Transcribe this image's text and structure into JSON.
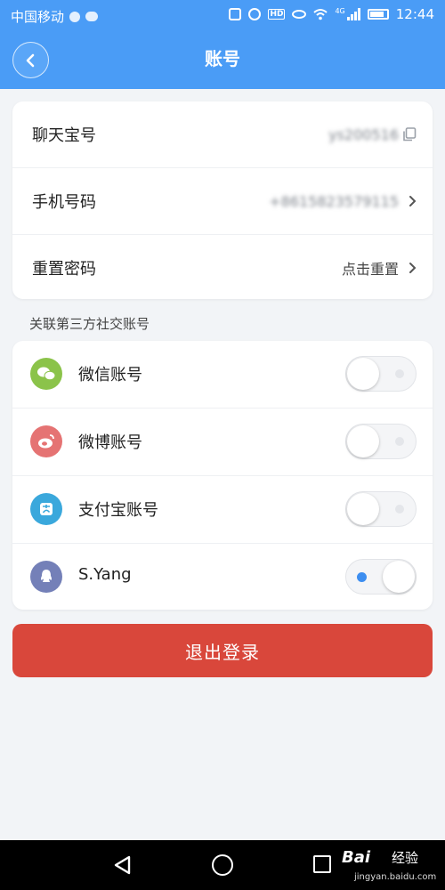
{
  "status_bar": {
    "carrier": "中国移动",
    "network_type": "4G",
    "hd_badge": "HD",
    "time": "12:44"
  },
  "header": {
    "title": "账号",
    "back_icon": "chevron-left-icon"
  },
  "account": {
    "rows": [
      {
        "label": "聊天宝号",
        "value": "ys200516",
        "icon": "copy-icon"
      },
      {
        "label": "手机号码",
        "value": "+8615823579115",
        "icon": "chevron-right-icon"
      },
      {
        "label": "重置密码",
        "value": "点击重置",
        "icon": "chevron-right-icon"
      }
    ]
  },
  "social": {
    "section_title": "关联第三方社交账号",
    "items": [
      {
        "label": "微信账号",
        "icon": "wechat-icon",
        "color": "#8bc34a",
        "enabled": false
      },
      {
        "label": "微博账号",
        "icon": "weibo-icon",
        "color": "#e57373",
        "enabled": false
      },
      {
        "label": "支付宝账号",
        "icon": "alipay-icon",
        "color": "#3aa8dc",
        "enabled": false
      },
      {
        "label": "S.Yang",
        "icon": "qq-icon",
        "color": "#7480b8",
        "enabled": true
      }
    ]
  },
  "logout": {
    "label": "退出登录",
    "color": "#d9473b"
  },
  "watermark": {
    "logo": "Bai",
    "brand": "经验",
    "url": "jingyan.baidu.com"
  },
  "colors": {
    "header": "#4a9cf6",
    "background": "#f2f4f7",
    "toggle_on_dot": "#3d8ef0"
  }
}
